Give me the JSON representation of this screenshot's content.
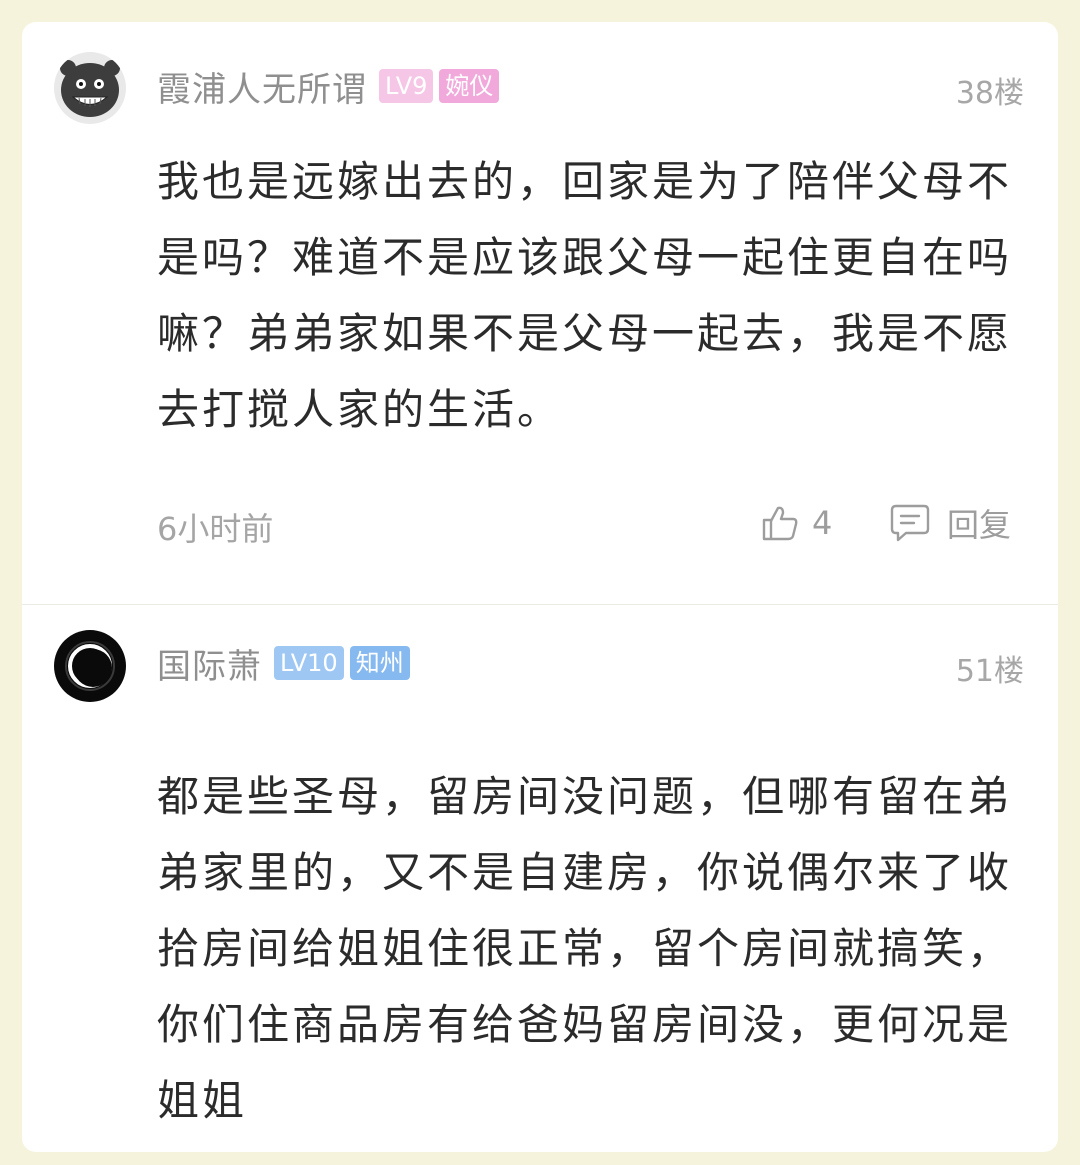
{
  "comments": [
    {
      "username": "霞浦人无所谓",
      "level": "LV9",
      "title_badge": "婉仪",
      "floor": "38楼",
      "content": "我也是远嫁出去的，回家是为了陪伴父母不是吗？难道不是应该跟父母一起住更自在吗嘛？弟弟家如果不是父母一起去，我是不愿去打搅人家的生活。",
      "time": "6小时前",
      "like_count": "4",
      "reply_label": "回复",
      "badge_colors": [
        "#f6c6e7",
        "#f1a9dc"
      ],
      "avatar_icon": "grinning-cartoon-face-icon"
    },
    {
      "username": "国际萧",
      "level": "LV10",
      "title_badge": "知州",
      "floor": "51楼",
      "content": "都是些圣母，留房间没问题，但哪有留在弟弟家里的，又不是自建房，你说偶尔来了收拾房间给姐姐住很正常，留个房间就搞笑，你们住商品房有给爸妈留房间没，更何况是姐姐",
      "badge_colors": [
        "#9ec7f4",
        "#86b9ef"
      ],
      "avatar_icon": "solar-eclipse-icon"
    }
  ],
  "icons": {
    "like": "thumbs-up-icon",
    "reply": "comment-bubble-icon"
  }
}
